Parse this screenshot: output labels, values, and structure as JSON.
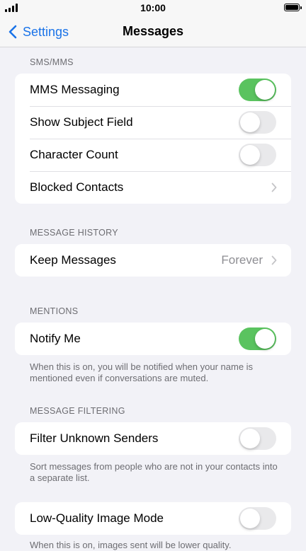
{
  "status_bar": {
    "time": "10:00"
  },
  "nav": {
    "back_label": "Settings",
    "title": "Messages"
  },
  "sections": {
    "sms_mms": {
      "header": "SMS/MMS",
      "rows": [
        {
          "label": "MMS Messaging",
          "toggle": true
        },
        {
          "label": "Show Subject Field",
          "toggle": false
        },
        {
          "label": "Character Count",
          "toggle": false
        },
        {
          "label": "Blocked Contacts"
        }
      ]
    },
    "message_history": {
      "header": "MESSAGE HISTORY",
      "rows": [
        {
          "label": "Keep Messages",
          "value": "Forever"
        }
      ]
    },
    "mentions": {
      "header": "MENTIONS",
      "rows": [
        {
          "label": "Notify Me",
          "toggle": true
        }
      ],
      "footer": "When this is on, you will be notified when your name is mentioned even if conversations are muted."
    },
    "message_filtering": {
      "header": "MESSAGE FILTERING",
      "rows": [
        {
          "label": "Filter Unknown Senders",
          "toggle": false
        }
      ],
      "footer": "Sort messages from people who are not in your contacts into a separate list."
    },
    "low_quality": {
      "rows": [
        {
          "label": "Low-Quality Image Mode",
          "toggle": false
        }
      ],
      "footer": "When this is on, images sent will be lower quality."
    }
  },
  "colors": {
    "accent": "#1a73e8",
    "toggle_on": "#5ac35f",
    "toggle_off": "#e9e9eb",
    "background": "#f2f2f7"
  }
}
